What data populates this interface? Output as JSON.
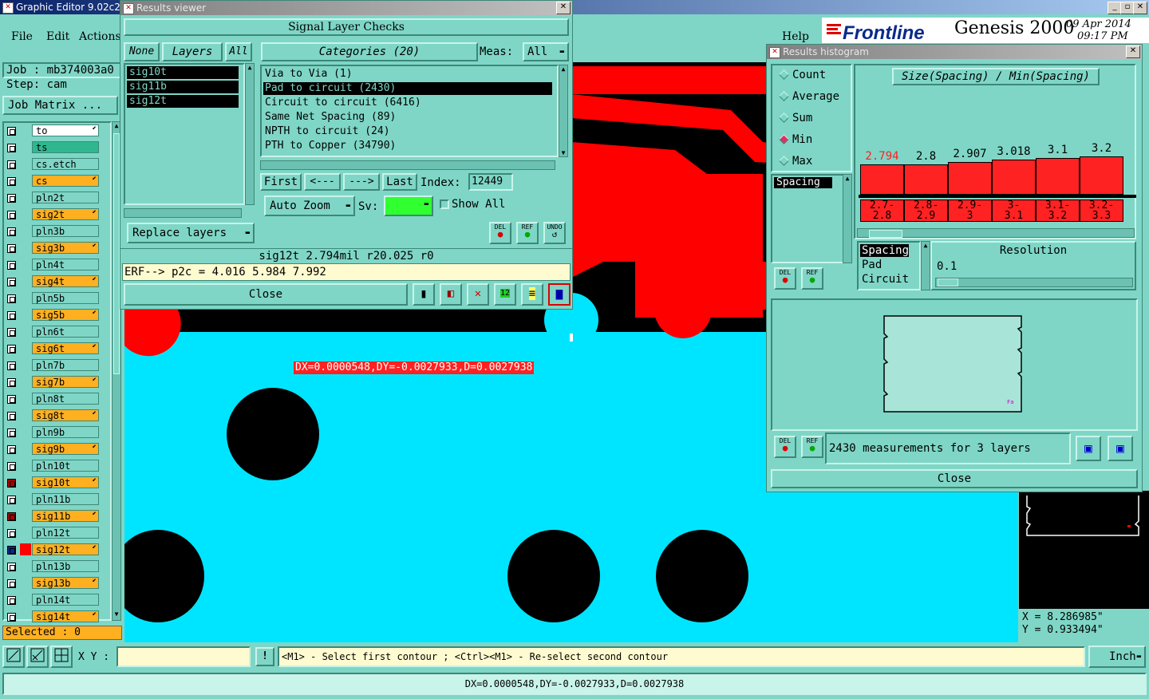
{
  "main_window": {
    "title": "Graphic Editor 9.02c2 (",
    "menu": [
      "File",
      "Edit",
      "Actions"
    ],
    "help": "Help",
    "brand": "Frontline",
    "product": "Genesis 2000",
    "date": "09 Apr 2014",
    "time": "09:17 PM",
    "job_label": "Job : mb374003a0",
    "step_label": "Step: cam",
    "job_matrix": "Job Matrix ...",
    "selected": "Selected : 0",
    "xy_label": "X Y :",
    "xy_value": "",
    "status_hint": "<M1> - Select first contour ; <Ctrl><M1> - Re-select second contour",
    "units": "Inch",
    "bottom_status": "DX=0.0000548,DY=-0.0027933,D=0.0027938",
    "canvas_measure": "DX=0.0000548,DY=-0.0027933,D=0.0027938",
    "coord_x": "X = 8.286985\"",
    "coord_y": "Y = 0.933494\""
  },
  "layers": [
    {
      "name": "to",
      "color": "#ffffff",
      "arrow": true
    },
    {
      "name": "ts",
      "color": "#2fb88f",
      "arrow": false
    },
    {
      "name": "cs.etch",
      "color": "#7fd6c6",
      "arrow": false
    },
    {
      "name": "cs",
      "color": "#ffb020",
      "arrow": true
    },
    {
      "name": "pln2t",
      "color": "#7fd6c6",
      "arrow": false
    },
    {
      "name": "sig2t",
      "color": "#ffb020",
      "arrow": true
    },
    {
      "name": "pln3b",
      "color": "#7fd6c6",
      "arrow": false
    },
    {
      "name": "sig3b",
      "color": "#ffb020",
      "arrow": true
    },
    {
      "name": "pln4t",
      "color": "#7fd6c6",
      "arrow": false
    },
    {
      "name": "sig4t",
      "color": "#ffb020",
      "arrow": true
    },
    {
      "name": "pln5b",
      "color": "#7fd6c6",
      "arrow": false
    },
    {
      "name": "sig5b",
      "color": "#ffb020",
      "arrow": true
    },
    {
      "name": "pln6t",
      "color": "#7fd6c6",
      "arrow": false
    },
    {
      "name": "sig6t",
      "color": "#ffb020",
      "arrow": true
    },
    {
      "name": "pln7b",
      "color": "#7fd6c6",
      "arrow": false
    },
    {
      "name": "sig7b",
      "color": "#ffb020",
      "arrow": true
    },
    {
      "name": "pln8t",
      "color": "#7fd6c6",
      "arrow": false
    },
    {
      "name": "sig8t",
      "color": "#ffb020",
      "arrow": true
    },
    {
      "name": "pln9b",
      "color": "#7fd6c6",
      "arrow": false
    },
    {
      "name": "sig9b",
      "color": "#ffb020",
      "arrow": true
    },
    {
      "name": "pln10t",
      "color": "#7fd6c6",
      "arrow": false
    },
    {
      "name": "sig10t",
      "color": "#ffb020",
      "arrow": true
    },
    {
      "name": "pln11b",
      "color": "#7fd6c6",
      "arrow": false
    },
    {
      "name": "sig11b",
      "color": "#ffb020",
      "arrow": true
    },
    {
      "name": "pln12t",
      "color": "#7fd6c6",
      "arrow": false
    },
    {
      "name": "sig12t",
      "color": "#ffb020",
      "arrow": true
    },
    {
      "name": "pln13b",
      "color": "#7fd6c6",
      "arrow": false
    },
    {
      "name": "sig13b",
      "color": "#ffb020",
      "arrow": true
    },
    {
      "name": "pln14t",
      "color": "#7fd6c6",
      "arrow": false
    },
    {
      "name": "sig14t",
      "color": "#ffb020",
      "arrow": true
    }
  ],
  "results_viewer": {
    "title": "Results viewer",
    "heading": "Signal Layer Checks",
    "none": "None",
    "layers_tab": "Layers",
    "all": "All",
    "categories_label": "Categories (20)",
    "meas_label": "Meas:",
    "meas_value": "All",
    "layer_list": [
      "sig10t",
      "sig11b",
      "sig12t"
    ],
    "categories": [
      "Via to Via (1)",
      "Pad to circuit (2430)",
      "Circuit to circuit (6416)",
      "Same Net Spacing (89)",
      "NPTH to circuit (24)",
      "PTH to Copper (34790)"
    ],
    "first": "First",
    "prev": "<---",
    "next": "--->",
    "last": "Last",
    "index_label": "Index:",
    "index_value": "12449",
    "auto_zoom": "Auto Zoom",
    "sv_label": "Sv:",
    "show_all": "Show All",
    "replace_layers": "Replace layers",
    "del": "DEL",
    "ref": "REF",
    "undo": "UNDO",
    "status": "sig12t 2.794mil  r20.025  r0",
    "erf": "ERF--> p2c = 4.016 5.984 7.992",
    "close": "Close"
  },
  "histogram": {
    "title": "Results histogram",
    "chart_title": "Size(Spacing) / Min(Spacing)",
    "modes": [
      "Count",
      "Average",
      "Sum",
      "Min",
      "Max"
    ],
    "selected_mode": "Min",
    "list_item": "Spacing",
    "bar_values": [
      "2.794",
      "2.8",
      "2.907",
      "3.018",
      "3.1",
      "3.2"
    ],
    "ranges": [
      [
        "2.7-",
        "2.8"
      ],
      [
        "2.8-",
        "2.9"
      ],
      [
        "2.9-",
        "3"
      ],
      [
        "3-",
        "3.1"
      ],
      [
        "3.1-",
        "3.2"
      ],
      [
        "3.2-",
        "3.3"
      ]
    ],
    "filters": [
      "Spacing",
      "Pad",
      "Circuit"
    ],
    "resolution_label": "Resolution",
    "resolution_value": "0.1",
    "del": "DEL",
    "ref": "REF",
    "summary": "2430 measurements for 3 layers",
    "close": "Close",
    "accent": "#ff2020",
    "highlight_value_color": "#ff2020"
  }
}
